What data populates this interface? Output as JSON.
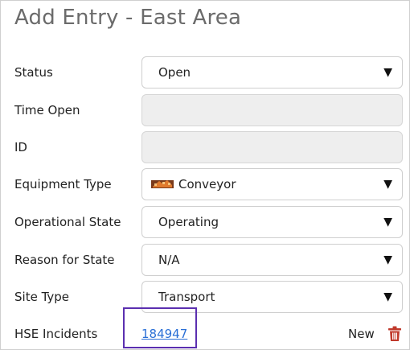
{
  "form": {
    "title": "Add Entry - East Area",
    "fields": {
      "status": {
        "label": "Status",
        "value": "Open"
      },
      "time_open": {
        "label": "Time Open",
        "value": ""
      },
      "id": {
        "label": "ID",
        "value": ""
      },
      "equipment_type": {
        "label": "Equipment Type",
        "value": "Conveyor",
        "icon": "conveyor-icon"
      },
      "operational_state": {
        "label": "Operational State",
        "value": "Operating"
      },
      "reason_for_state": {
        "label": "Reason for State",
        "value": "N/A"
      },
      "site_type": {
        "label": "Site Type",
        "value": "Transport"
      },
      "hse_incidents": {
        "label": "HSE Incidents",
        "value": "184947",
        "new_label": "New"
      }
    },
    "dropdown_arrow": "▼",
    "colors": {
      "title": "#6b6b6b",
      "link": "#2a6fd6",
      "highlight": "#5b2fb0",
      "trash": "#c0392b",
      "disabled_bg": "#eeeeee"
    }
  }
}
